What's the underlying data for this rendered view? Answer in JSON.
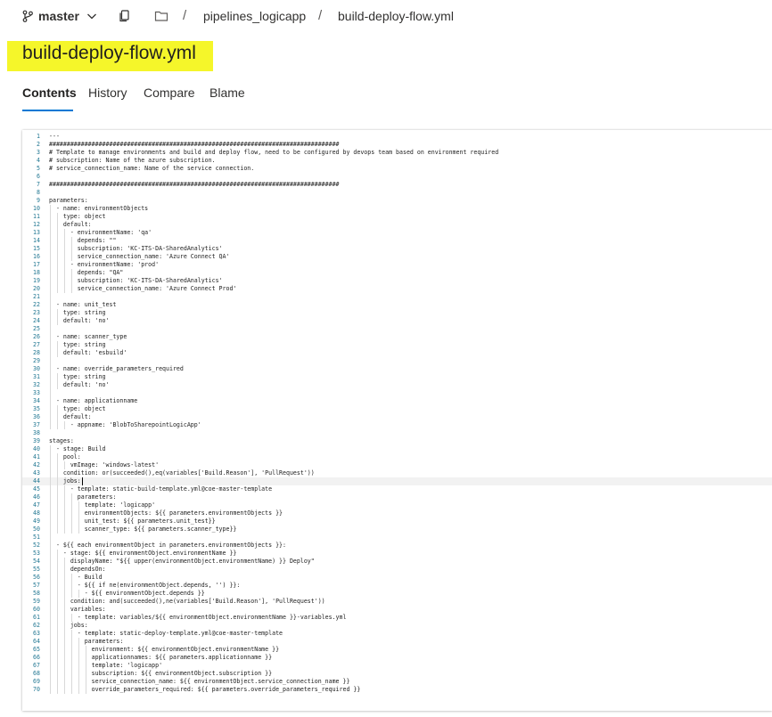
{
  "header": {
    "branch": "master",
    "breadcrumb": [
      "pipelines_logicapp",
      "build-deploy-flow.yml"
    ],
    "separator": "/",
    "icons": {
      "branch": "git-branch-icon",
      "chevron": "chevron-down-icon",
      "copy": "copy-icon",
      "folder": "folder-icon"
    }
  },
  "file": {
    "title": "build-deploy-flow.yml",
    "highlight_color": "#f5f62a"
  },
  "tabs": [
    {
      "label": "Contents",
      "active": true
    },
    {
      "label": "History",
      "active": false
    },
    {
      "label": "Compare",
      "active": false
    },
    {
      "label": "Blame",
      "active": false
    }
  ],
  "colors": {
    "accent": "#0078d4",
    "line_number": "#237893"
  },
  "editor": {
    "current_line": 44,
    "lines": [
      "---",
      "##################################################################################",
      "# Template to manage environments and build and deploy flow, need to be configured by devops team based on environment required",
      "# subscription: Name of the azure subscription.",
      "# service_connection_name: Name of the service connection.",
      "",
      "##################################################################################",
      "",
      "parameters:",
      "  - name: environmentObjects",
      "    type: object",
      "    default:",
      "      - environmentName: 'qa'",
      "        depends: \"\"",
      "        subscription: 'KC-ITS-DA-SharedAnalytics'",
      "        service_connection_name: 'Azure Connect QA'",
      "      - environmentName: 'prod'",
      "        depends: \"QA\"",
      "        subscription: 'KC-ITS-DA-SharedAnalytics'",
      "        service_connection_name: 'Azure Connect Prod'",
      "",
      "  - name: unit_test",
      "    type: string",
      "    default: 'no'",
      "",
      "  - name: scanner_type",
      "    type: string",
      "    default: 'esbuild'",
      "",
      "  - name: override_parameters_required",
      "    type: string",
      "    default: 'no'",
      "",
      "  - name: applicationname",
      "    type: object",
      "    default:",
      "      - appname: 'BlobToSharepointLogicApp'",
      "",
      "stages:",
      "  - stage: Build",
      "    pool:",
      "      vmImage: 'windows-latest'",
      "    condition: or(succeeded(),eq(variables['Build.Reason'], 'PullRequest'))",
      "    jobs:",
      "      - template: static-build-template.yml@coe-master-template",
      "        parameters:",
      "          template: 'logicapp'",
      "          environmentObjects: ${{ parameters.environmentObjects }}",
      "          unit_test: ${{ parameters.unit_test}}",
      "          scanner_type: ${{ parameters.scanner_type}}",
      "",
      "  - ${{ each environmentObject in parameters.environmentObjects }}:",
      "    - stage: ${{ environmentObject.environmentName }}",
      "      displayName: \"${{ upper(environmentObject.environmentName) }} Deploy\"",
      "      dependsOn:",
      "        - Build",
      "        - ${{ if ne(environmentObject.depends, '') }}:",
      "          - ${{ environmentObject.depends }}",
      "      condition: and(succeeded(),ne(variables['Build.Reason'], 'PullRequest'))",
      "      variables:",
      "        - template: variables/${{ environmentObject.environmentName }}-variables.yml",
      "      jobs:",
      "        - template: static-deploy-template.yml@coe-master-template",
      "          parameters:",
      "            environment: ${{ environmentObject.environmentName }}",
      "            applicationnames: ${{ parameters.applicationname }}",
      "            template: 'logicapp'",
      "            subscription: ${{ environmentObject.subscription }}",
      "            service_connection_name: ${{ environmentObject.service_connection_name }}",
      "            override_parameters_required: ${{ parameters.override_parameters_required }}"
    ]
  }
}
